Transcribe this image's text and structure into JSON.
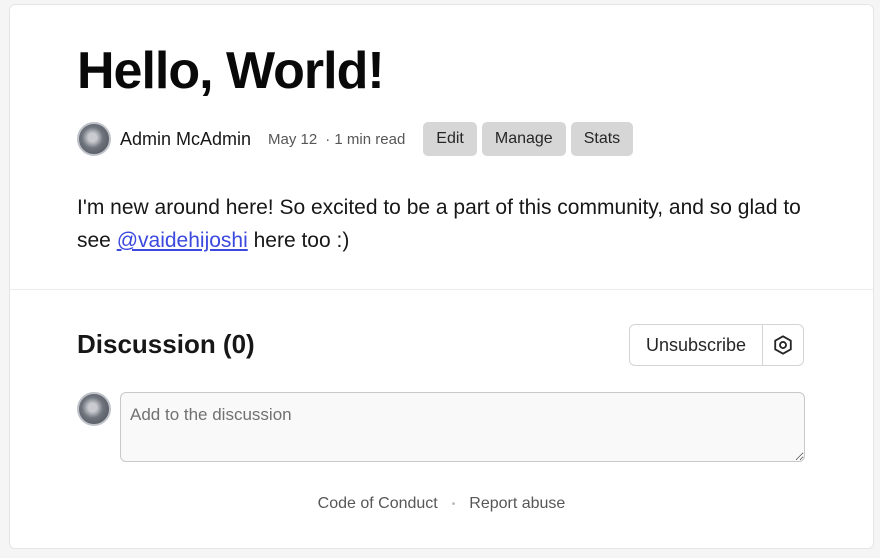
{
  "article": {
    "title": "Hello, World!",
    "author": "Admin McAdmin",
    "date": "May 12",
    "read_time": "· 1 min read",
    "actions": {
      "edit": "Edit",
      "manage": "Manage",
      "stats": "Stats"
    },
    "body_before": "I'm new around here! So excited to be a part of this community, and so glad to see ",
    "mention": "@vaidehijoshi",
    "body_after": " here too :)"
  },
  "discussion": {
    "title": "Discussion (0)",
    "unsubscribe_label": "Unsubscribe",
    "placeholder": "Add to the discussion"
  },
  "footer": {
    "code_of_conduct": "Code of Conduct",
    "report_abuse": "Report abuse",
    "separator": "•"
  },
  "icons": {
    "author_avatar": "avatar",
    "settings": "hexagon-gear-icon"
  }
}
